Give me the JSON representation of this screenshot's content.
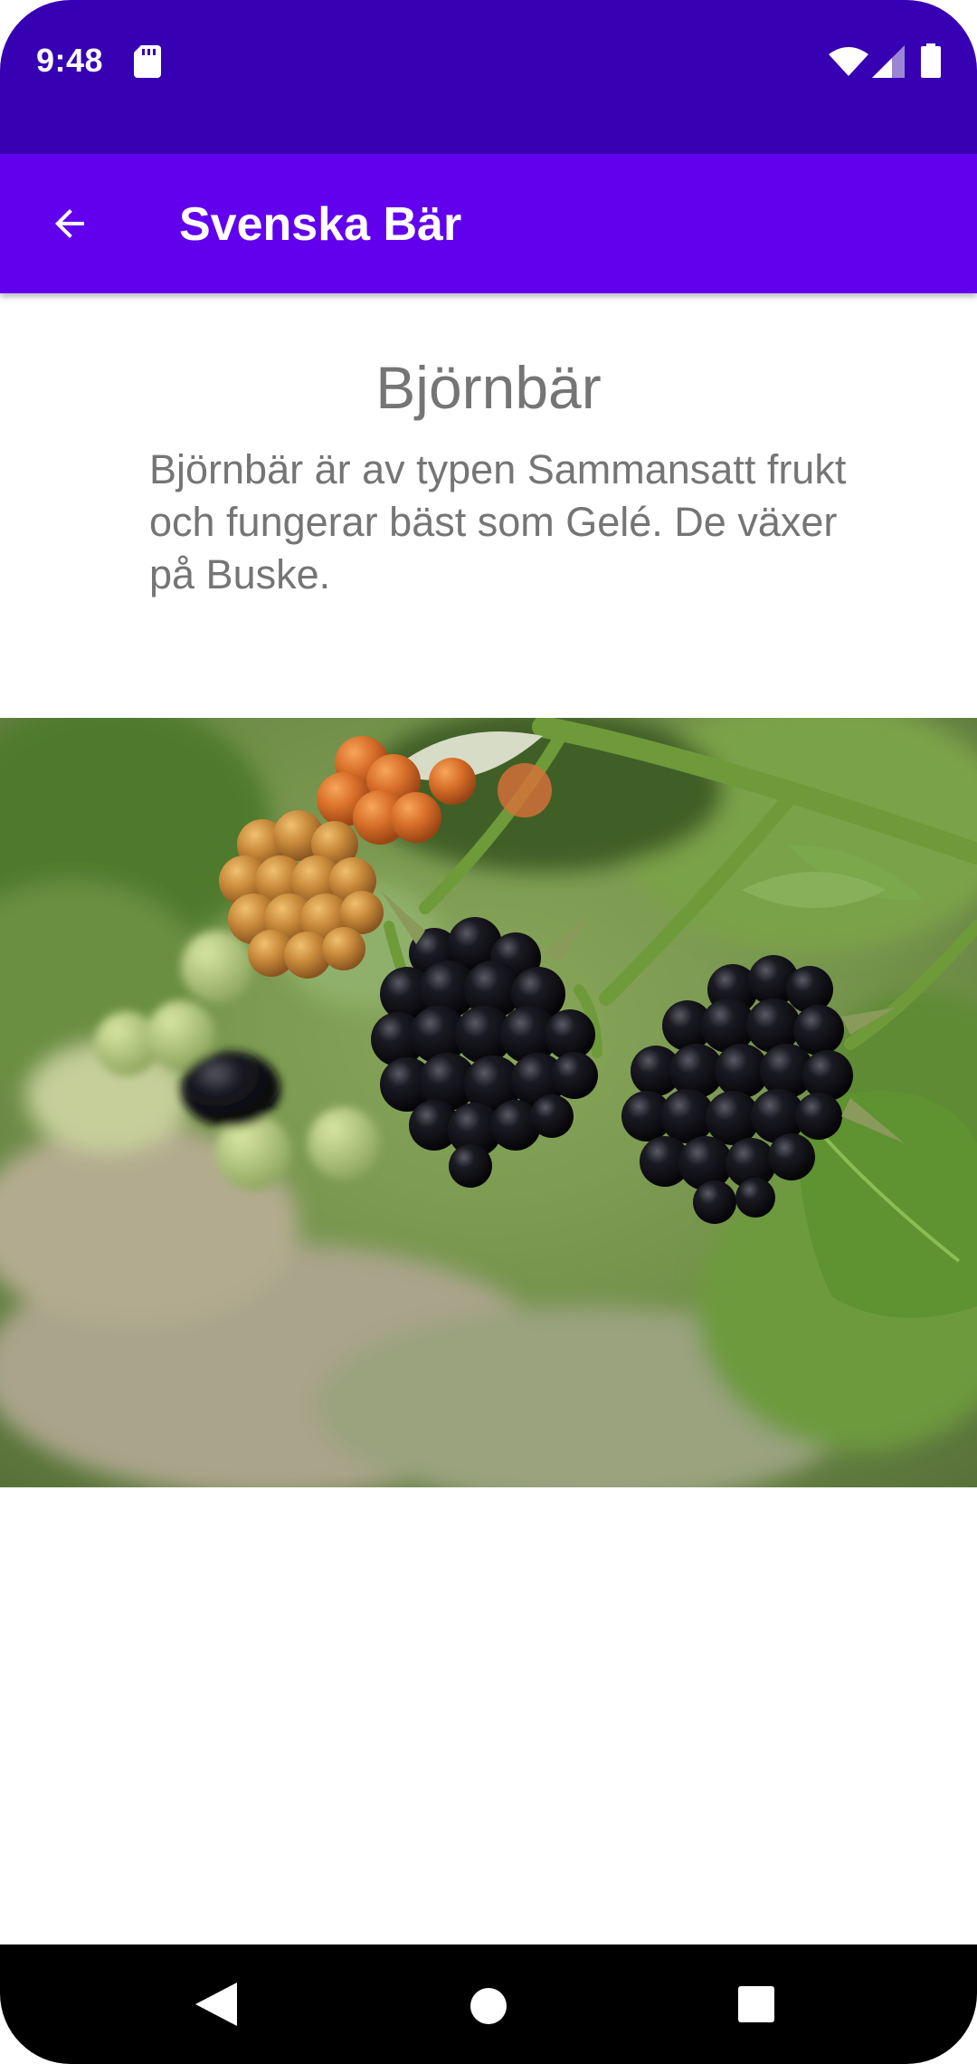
{
  "status_bar": {
    "time": "9:48",
    "icons": [
      "sd-card-icon",
      "wifi-icon",
      "signal-icon",
      "battery-icon"
    ],
    "color": "#3700b3"
  },
  "app_bar": {
    "title": "Svenska Bär",
    "back_icon": "arrow-back-icon",
    "color": "#6200ee"
  },
  "berry": {
    "name": "Björnbär",
    "description": "Björnbär är av typen Sammansatt frukt och fungerar bäst som Gelé. De växer på Buske.",
    "image": "blackberry-photo"
  },
  "nav_bar": {
    "icons": [
      "nav-back-icon",
      "nav-home-icon",
      "nav-recents-icon"
    ]
  }
}
